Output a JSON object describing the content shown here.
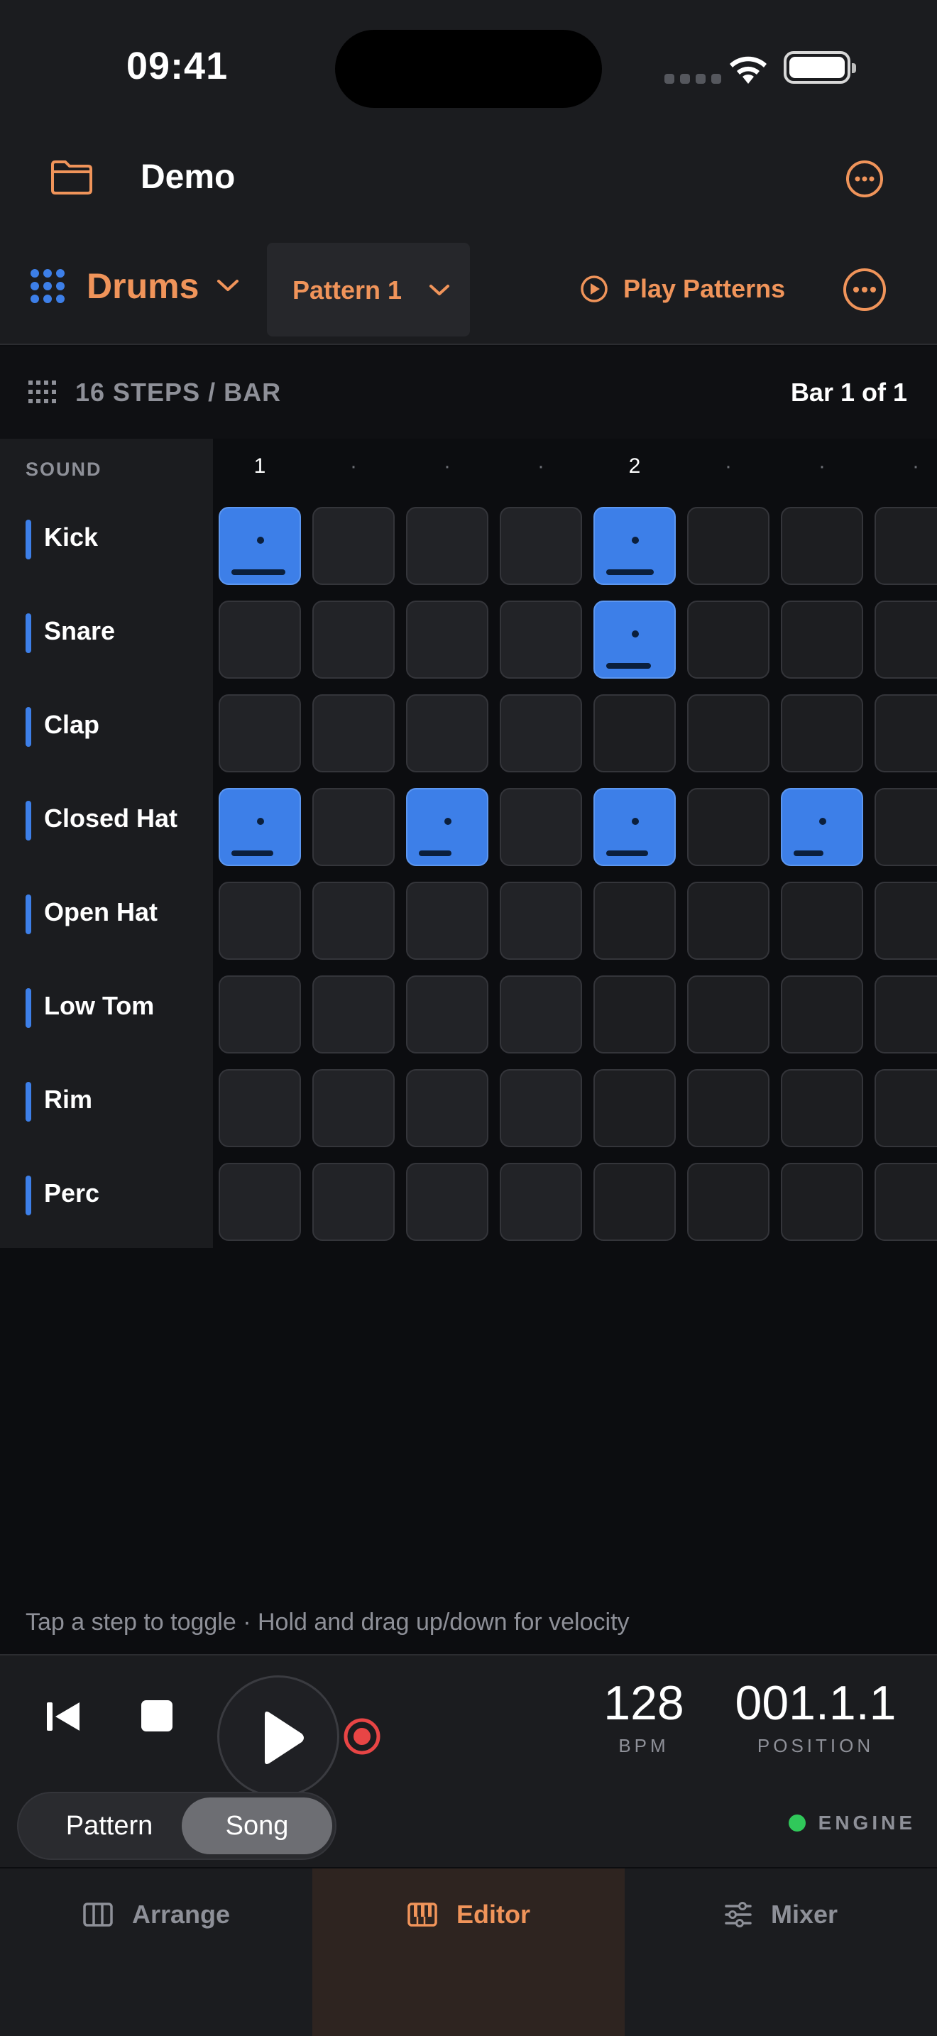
{
  "status_bar": {
    "time": "09:41"
  },
  "header": {
    "project_name": "Demo",
    "folder_icon": "folder-icon",
    "more_icon": "more-icon"
  },
  "track_bar": {
    "track_name": "Drums",
    "pattern_label": "Pattern 1",
    "play_patterns_label": "Play Patterns"
  },
  "steps_bar": {
    "steps_label": "16 STEPS / BAR",
    "bar_label": "Bar 1 of 1"
  },
  "sequencer": {
    "sound_header": "SOUND",
    "beat_labels": [
      "1",
      "·",
      "·",
      "·",
      "2",
      "·",
      "·",
      "·"
    ],
    "sounds": [
      {
        "name": "Kick"
      },
      {
        "name": "Snare"
      },
      {
        "name": "Clap"
      },
      {
        "name": "Closed Hat"
      },
      {
        "name": "Open Hat"
      },
      {
        "name": "Low Tom"
      },
      {
        "name": "Rim"
      },
      {
        "name": "Perc"
      }
    ],
    "active_steps": [
      {
        "row": 0,
        "step": 0,
        "velocity": 0.9
      },
      {
        "row": 0,
        "step": 4,
        "velocity": 0.8
      },
      {
        "row": 1,
        "step": 4,
        "velocity": 0.75
      },
      {
        "row": 3,
        "step": 0,
        "velocity": 0.7
      },
      {
        "row": 3,
        "step": 2,
        "velocity": 0.55
      },
      {
        "row": 3,
        "step": 4,
        "velocity": 0.7
      },
      {
        "row": 3,
        "step": 6,
        "velocity": 0.5
      }
    ],
    "accent_color": "#3d7fe8"
  },
  "hint": "Tap a step to toggle · Hold and drag up/down for velocity",
  "transport": {
    "bpm": "128",
    "bpm_label": "BPM",
    "position": "001.1.1",
    "position_label": "POSITION",
    "mode_options": [
      "Pattern",
      "Song"
    ],
    "mode_selected": "Song",
    "engine_label": "ENGINE",
    "engine_status_color": "#30c85a"
  },
  "tabs": [
    {
      "label": "Arrange",
      "icon": "arrange-icon"
    },
    {
      "label": "Editor",
      "icon": "piano-keys-icon"
    },
    {
      "label": "Mixer",
      "icon": "sliders-icon"
    }
  ],
  "active_tab": "Editor",
  "brand_color": "#f0945a"
}
